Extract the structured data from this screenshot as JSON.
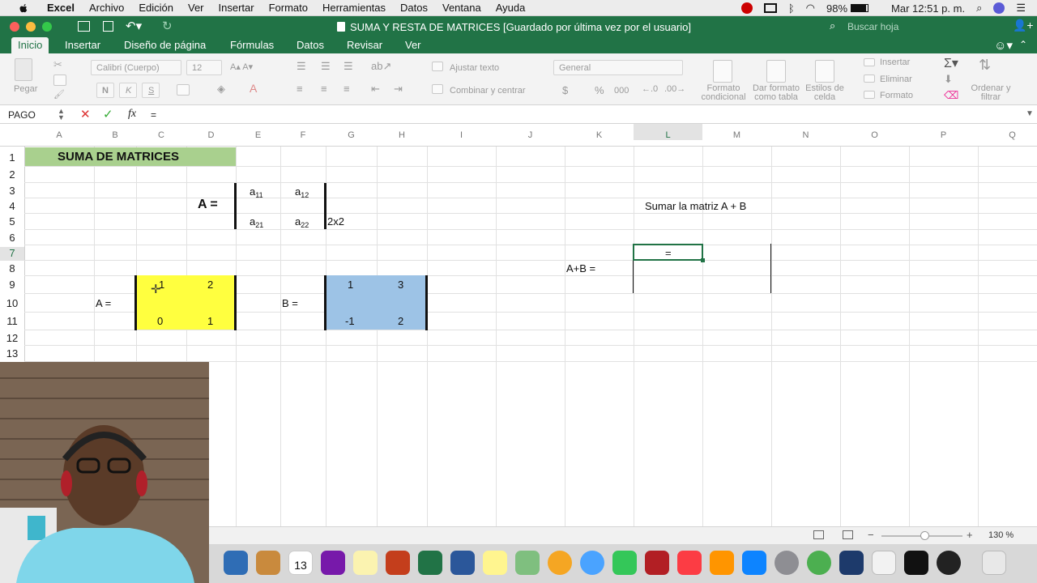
{
  "menubar": {
    "app": "Excel",
    "items": [
      "Archivo",
      "Edición",
      "Ver",
      "Insertar",
      "Formato",
      "Herramientas",
      "Datos",
      "Ventana",
      "Ayuda"
    ],
    "battery": "98%",
    "clock": "Mar 12:51 p. m."
  },
  "window": {
    "title": "SUMA Y RESTA DE MATRICES [Guardado por última vez por el usuario]",
    "search_placeholder": "Buscar hoja"
  },
  "tabs": [
    "Inicio",
    "Insertar",
    "Diseño de página",
    "Fórmulas",
    "Datos",
    "Revisar",
    "Ver"
  ],
  "ribbon": {
    "paste": "Pegar",
    "font_name": "Calibri (Cuerpo)",
    "font_size": "12",
    "bold": "N",
    "italic": "K",
    "underline": "S",
    "wrap": "Ajustar texto",
    "merge": "Combinar y centrar",
    "number_format": "General",
    "currency": "$",
    "percent": "%",
    "thousands": "000",
    "cond_format": "Formato condicional",
    "table_format": "Dar formato como tabla",
    "cell_styles": "Estilos de celda",
    "insert": "Insertar",
    "delete": "Eliminar",
    "format": "Formato",
    "sort": "Ordenar y filtrar"
  },
  "formula_bar": {
    "name_box": "PAGO",
    "fx": "fx",
    "content": "="
  },
  "columns": [
    "A",
    "B",
    "C",
    "D",
    "E",
    "F",
    "G",
    "H",
    "I",
    "J",
    "K",
    "L",
    "M",
    "N",
    "O",
    "P",
    "Q"
  ],
  "rows": [
    "1",
    "2",
    "3",
    "4",
    "5",
    "6",
    "7",
    "8",
    "9",
    "10",
    "11",
    "12",
    "13"
  ],
  "sheet": {
    "title": "SUMA  DE MATRICES",
    "a_label_generic": "A =",
    "a11": "a",
    "a11s": "11",
    "a12": "a",
    "a12s": "12",
    "a21": "a",
    "a21s": "21",
    "a22": "a",
    "a22s": "22",
    "dims": "2x2",
    "instruction": "Sumar la matriz  A + B",
    "active_cell": "=",
    "sum_label": "A+B =",
    "matrix_a_label": "A =",
    "matrix_a": [
      "1",
      "2",
      "0",
      "1"
    ],
    "matrix_b_label": "B =",
    "matrix_b": [
      "1",
      "3",
      "-1",
      "2"
    ]
  },
  "status": {
    "zoom": "130 %",
    "minus": "−",
    "plus": "+"
  },
  "dock": {
    "calendar_day": "13"
  },
  "colors": {
    "excel_green": "#217346",
    "title_fill": "#a9d08e",
    "matrix_a_fill": "#ffff3f",
    "matrix_b_fill": "#9dc3e6"
  }
}
